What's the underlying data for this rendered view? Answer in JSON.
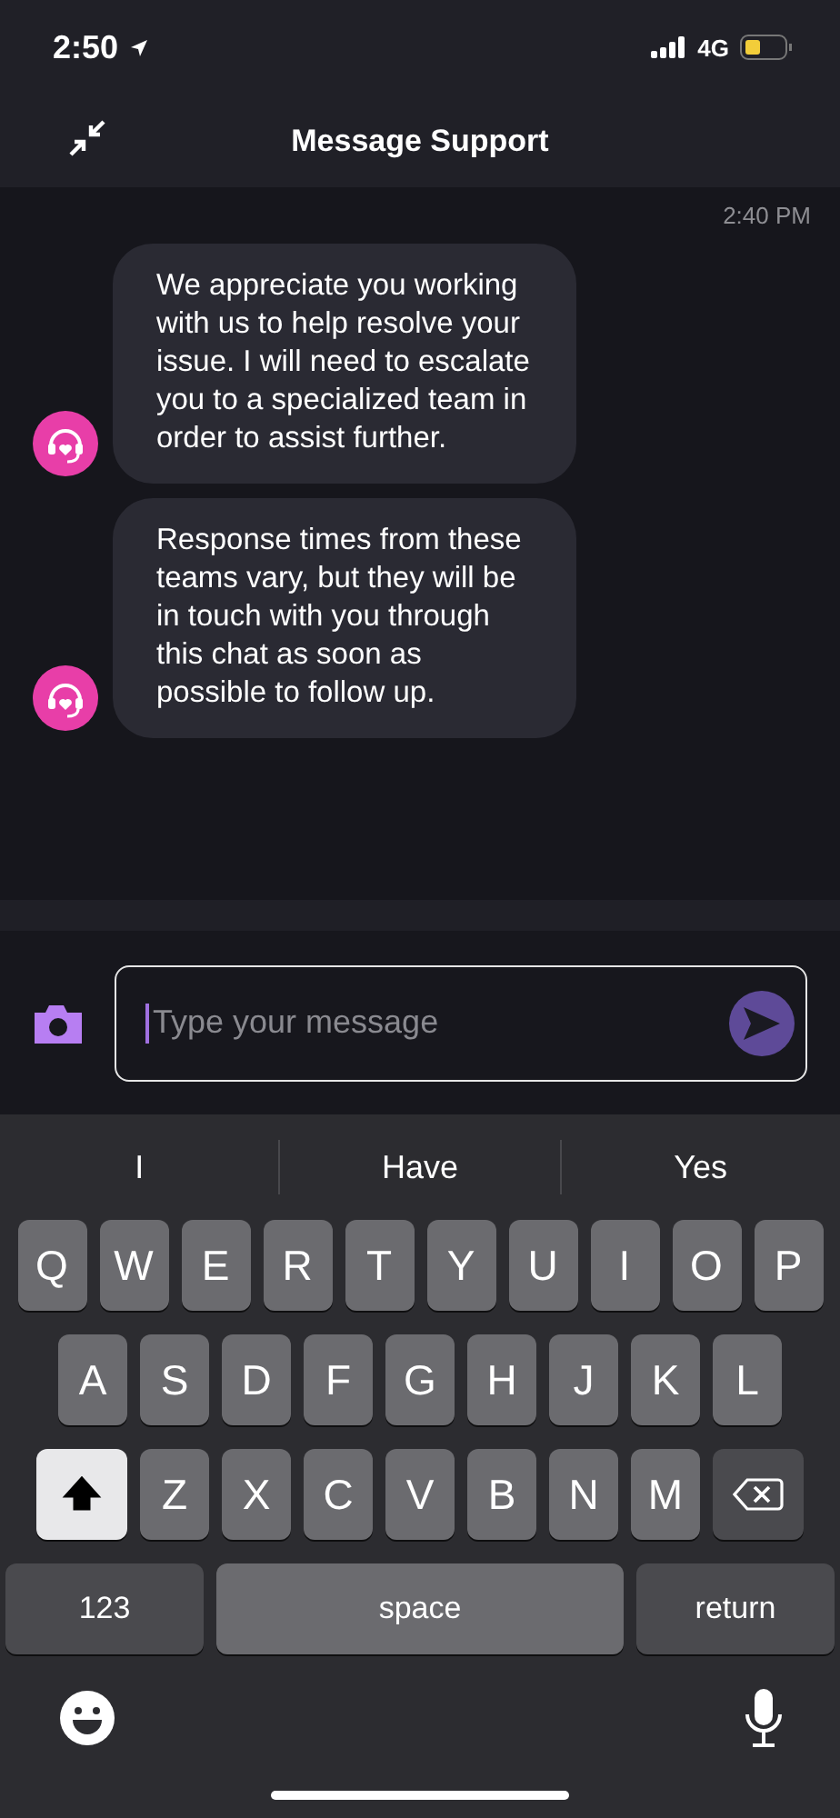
{
  "status_bar": {
    "time": "2:50",
    "network": "4G"
  },
  "header": {
    "title": "Message Support"
  },
  "chat": {
    "timestamp": "2:40 PM",
    "messages": [
      {
        "text": "We appreciate you working with us to help resolve your issue. I will need to escalate you to a specialized team in order to assist further."
      },
      {
        "text": "Response times from these teams vary, but they will be in touch with you through this chat as soon as possible to follow up."
      }
    ]
  },
  "composer": {
    "placeholder": "Type your message"
  },
  "keyboard": {
    "suggestions": [
      "I",
      "Have",
      "Yes"
    ],
    "rows": [
      [
        {
          "kind": "letter",
          "label": "Q"
        },
        {
          "kind": "letter",
          "label": "W"
        },
        {
          "kind": "letter",
          "label": "E"
        },
        {
          "kind": "letter",
          "label": "R"
        },
        {
          "kind": "letter",
          "label": "T"
        },
        {
          "kind": "letter",
          "label": "Y"
        },
        {
          "kind": "letter",
          "label": "U"
        },
        {
          "kind": "letter",
          "label": "I"
        },
        {
          "kind": "letter",
          "label": "O"
        },
        {
          "kind": "letter",
          "label": "P"
        }
      ],
      [
        {
          "kind": "letter",
          "label": "A"
        },
        {
          "kind": "letter",
          "label": "S"
        },
        {
          "kind": "letter",
          "label": "D"
        },
        {
          "kind": "letter",
          "label": "F"
        },
        {
          "kind": "letter",
          "label": "G"
        },
        {
          "kind": "letter",
          "label": "H"
        },
        {
          "kind": "letter",
          "label": "J"
        },
        {
          "kind": "letter",
          "label": "K"
        },
        {
          "kind": "letter",
          "label": "L"
        }
      ],
      [
        {
          "kind": "shift",
          "on": true
        },
        {
          "kind": "letter",
          "label": "Z"
        },
        {
          "kind": "letter",
          "label": "X"
        },
        {
          "kind": "letter",
          "label": "C"
        },
        {
          "kind": "letter",
          "label": "V"
        },
        {
          "kind": "letter",
          "label": "B"
        },
        {
          "kind": "letter",
          "label": "N"
        },
        {
          "kind": "letter",
          "label": "M"
        },
        {
          "kind": "backspace"
        }
      ]
    ],
    "bottom_keys": [
      {
        "kind": "mode",
        "label": "123"
      },
      {
        "kind": "space",
        "label": "space"
      },
      {
        "kind": "return",
        "label": "return"
      }
    ]
  }
}
